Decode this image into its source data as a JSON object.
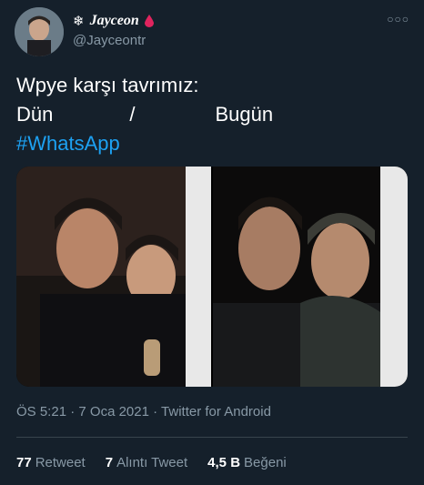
{
  "author": {
    "name": "Jayceon",
    "handle": "@Jayceontr"
  },
  "tweet": {
    "line1": "Wpye karşı tavrımız:",
    "line2_left": "Dün",
    "line2_sep": "/",
    "line2_right": "Bugün",
    "hashtag": "#WhatsApp"
  },
  "meta": {
    "time": "ÖS 5:21",
    "date": "7 Oca 2021",
    "source": "Twitter for Android"
  },
  "stats": {
    "retweets_value": "77",
    "retweets_label": "Retweet",
    "quotes_value": "7",
    "quotes_label": "Alıntı Tweet",
    "likes_value": "4,5 B",
    "likes_label": "Beğeni"
  },
  "icons": {
    "more": "more-options-icon",
    "snowflake": "snowflake-icon",
    "drop": "blood-drop-icon"
  },
  "colors": {
    "background": "#15202b",
    "link": "#1da1f2",
    "muted": "#8899a6",
    "divider": "#38444d",
    "drop": "#e0245e"
  }
}
